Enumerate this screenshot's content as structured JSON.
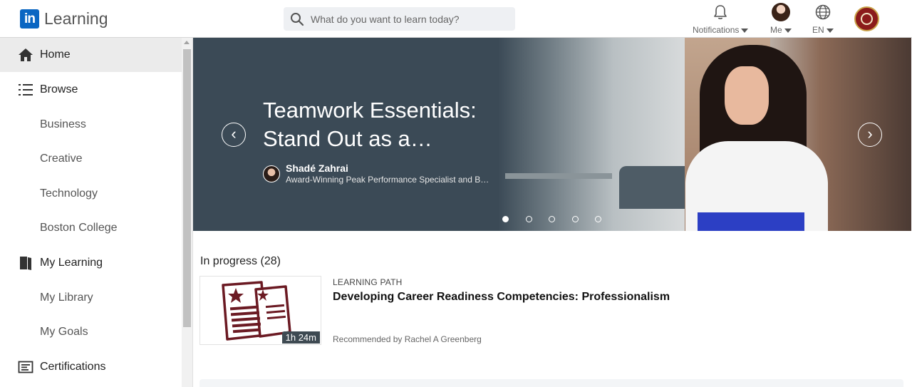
{
  "header": {
    "logo_mark": "in",
    "logo_text": "Learning",
    "search_placeholder": "What do you want to learn today?",
    "notifications_label": "Notifications",
    "me_label": "Me",
    "language_label": "EN"
  },
  "sidebar": {
    "items": [
      {
        "label": "Home",
        "icon": "home-icon",
        "active": true
      },
      {
        "label": "Browse",
        "icon": "list-icon"
      },
      {
        "label": "Business"
      },
      {
        "label": "Creative"
      },
      {
        "label": "Technology"
      },
      {
        "label": "Boston College"
      },
      {
        "label": "My Learning",
        "icon": "book-icon"
      },
      {
        "label": "My Library"
      },
      {
        "label": "My Goals"
      },
      {
        "label": "Certifications",
        "icon": "certificate-icon"
      }
    ]
  },
  "hero": {
    "title_line1": "Teamwork Essentials:",
    "title_line2": "Stand Out as a…",
    "author_name": "Shadé Zahrai",
    "author_title": "Award-Winning Peak Performance Specialist and B…",
    "prev_arrow": "‹",
    "next_arrow": "›",
    "slide_count": 5,
    "active_slide": 1
  },
  "in_progress": {
    "heading": "In progress (28)",
    "card": {
      "kicker": "LEARNING PATH",
      "title": "Developing Career Readiness Competencies: Professionalism",
      "duration": "1h 24m",
      "recommended": "Recommended by Rachel A Greenberg"
    }
  },
  "colors": {
    "brand_blue": "#0a66c2",
    "hero_bg": "#3b4a56",
    "thumbnail_maroon": "#6b1a23"
  }
}
